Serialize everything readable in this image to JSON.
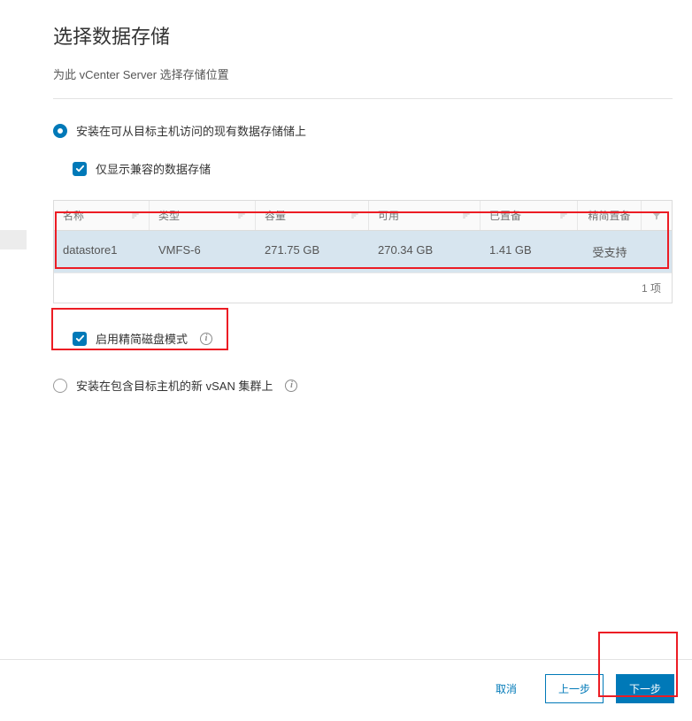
{
  "page_title": "选择数据存储",
  "subtitle": "为此 vCenter Server 选择存储位置",
  "option_existing": "安装在可从目标主机访问的现有数据存储储上",
  "show_compatible": "仅显示兼容的数据存储",
  "table": {
    "headers": {
      "name": "名称",
      "type": "类型",
      "capacity": "容量",
      "free": "可用",
      "provisioned": "已置备",
      "thin": "精简置备"
    },
    "rows": [
      {
        "name": "datastore1",
        "type": "VMFS-6",
        "capacity": "271.75 GB",
        "free": "270.34 GB",
        "provisioned": "1.41 GB",
        "thin": "受支持"
      }
    ],
    "footer": "1 项"
  },
  "enable_thin": "启用精简磁盘模式",
  "option_vsan": "安装在包含目标主机的新 vSAN 集群上",
  "footer": {
    "cancel": "取消",
    "back": "上一步",
    "next": "下一步"
  }
}
